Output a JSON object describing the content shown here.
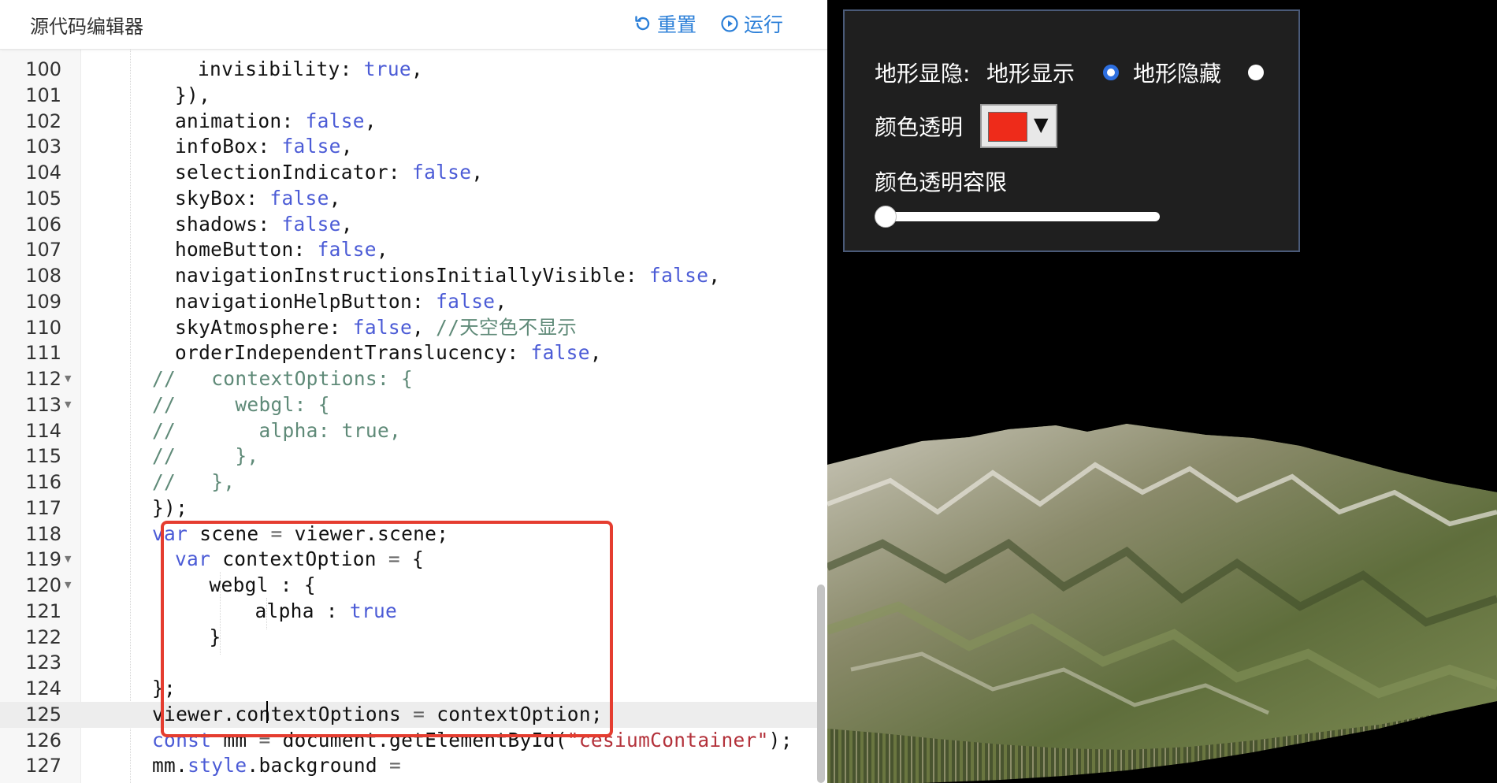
{
  "editor": {
    "title": "源代码编辑器",
    "reset_label": "重置",
    "run_label": "运行",
    "lines": [
      {
        "n": "100",
        "indent": 1,
        "tokens": [
          [
            "key",
            "invisibility: "
          ],
          [
            "lit",
            "true"
          ],
          [
            "key",
            ","
          ]
        ]
      },
      {
        "n": "101",
        "indent": 0,
        "tokens": [
          [
            "key",
            "}),"
          ]
        ]
      },
      {
        "n": "102",
        "indent": 0,
        "tokens": [
          [
            "key",
            "animation: "
          ],
          [
            "lit",
            "false"
          ],
          [
            "key",
            ","
          ]
        ]
      },
      {
        "n": "103",
        "indent": 0,
        "tokens": [
          [
            "key",
            "infoBox: "
          ],
          [
            "lit",
            "false"
          ],
          [
            "key",
            ","
          ]
        ]
      },
      {
        "n": "104",
        "indent": 0,
        "tokens": [
          [
            "key",
            "selectionIndicator: "
          ],
          [
            "lit",
            "false"
          ],
          [
            "key",
            ","
          ]
        ]
      },
      {
        "n": "105",
        "indent": 0,
        "tokens": [
          [
            "key",
            "skyBox: "
          ],
          [
            "lit",
            "false"
          ],
          [
            "key",
            ","
          ]
        ]
      },
      {
        "n": "106",
        "indent": 0,
        "tokens": [
          [
            "key",
            "shadows: "
          ],
          [
            "lit",
            "false"
          ],
          [
            "key",
            ","
          ]
        ]
      },
      {
        "n": "107",
        "indent": 0,
        "tokens": [
          [
            "key",
            "homeButton: "
          ],
          [
            "lit",
            "false"
          ],
          [
            "key",
            ","
          ]
        ]
      },
      {
        "n": "108",
        "indent": 0,
        "tokens": [
          [
            "key",
            "navigationInstructionsInitiallyVisible: "
          ],
          [
            "lit",
            "false"
          ],
          [
            "key",
            ","
          ]
        ]
      },
      {
        "n": "109",
        "indent": 0,
        "tokens": [
          [
            "key",
            "navigationHelpButton: "
          ],
          [
            "lit",
            "false"
          ],
          [
            "key",
            ","
          ]
        ]
      },
      {
        "n": "110",
        "indent": 0,
        "tokens": [
          [
            "key",
            "skyAtmosphere: "
          ],
          [
            "lit",
            "false"
          ],
          [
            "key",
            ", "
          ],
          [
            "cmt",
            "//天空色不显示"
          ]
        ]
      },
      {
        "n": "111",
        "indent": 0,
        "tokens": [
          [
            "key",
            "orderIndependentTranslucency: "
          ],
          [
            "lit",
            "false"
          ],
          [
            "key",
            ","
          ]
        ]
      },
      {
        "n": "112",
        "indent": -1,
        "fold": true,
        "tokens": [
          [
            "cmt",
            "//   contextOptions: {"
          ]
        ]
      },
      {
        "n": "113",
        "indent": -1,
        "fold": true,
        "tokens": [
          [
            "cmt",
            "//     webgl: {"
          ]
        ]
      },
      {
        "n": "114",
        "indent": -1,
        "tokens": [
          [
            "cmt",
            "//       alpha: true,"
          ]
        ]
      },
      {
        "n": "115",
        "indent": -1,
        "tokens": [
          [
            "cmt",
            "//     },"
          ]
        ]
      },
      {
        "n": "116",
        "indent": -1,
        "tokens": [
          [
            "cmt",
            "//   },"
          ]
        ]
      },
      {
        "n": "117",
        "indent": -1,
        "tokens": [
          [
            "key",
            "});"
          ]
        ]
      },
      {
        "n": "118",
        "indent": -1,
        "tokens": [
          [
            "kw",
            "var"
          ],
          [
            "key",
            " scene "
          ],
          [
            "op",
            "="
          ],
          [
            "key",
            " viewer.scene;"
          ]
        ]
      },
      {
        "n": "119",
        "indent": 0,
        "fold": true,
        "tokens": [
          [
            "kw",
            "var"
          ],
          [
            "key",
            " contextOption "
          ],
          [
            "op",
            "="
          ],
          [
            "key",
            " {"
          ]
        ]
      },
      {
        "n": "120",
        "indent": 1.5,
        "fold": true,
        "tokens": [
          [
            "key",
            "webgl : {"
          ]
        ]
      },
      {
        "n": "121",
        "indent": 3.5,
        "tokens": [
          [
            "key",
            "alpha : "
          ],
          [
            "lit",
            "true"
          ]
        ]
      },
      {
        "n": "122",
        "indent": 1.5,
        "tokens": [
          [
            "key",
            "}"
          ]
        ]
      },
      {
        "n": "123",
        "indent": 0,
        "tokens": []
      },
      {
        "n": "124",
        "indent": -1,
        "tokens": [
          [
            "key",
            "};"
          ]
        ]
      },
      {
        "n": "125",
        "indent": -1,
        "active": true,
        "tokens": [
          [
            "key",
            "viewer.contextOptions "
          ],
          [
            "op",
            "="
          ],
          [
            "key",
            " contextOption;"
          ]
        ]
      },
      {
        "n": "126",
        "indent": -1,
        "tokens": [
          [
            "kw",
            "const"
          ],
          [
            "key",
            " mm "
          ],
          [
            "op",
            "="
          ],
          [
            "key",
            " document.getElementById("
          ],
          [
            "str",
            "\"cesiumContainer\""
          ],
          [
            "key",
            ");"
          ]
        ]
      },
      {
        "n": "127",
        "indent": -1,
        "tokens": [
          [
            "key",
            "mm."
          ],
          [
            "kw",
            "style"
          ],
          [
            "key",
            ".background "
          ],
          [
            "op",
            "="
          ]
        ]
      }
    ]
  },
  "panel": {
    "terrain_label": "地形显隐:",
    "show_label": "地形显示",
    "hide_label": "地形隐藏",
    "terrain_selected": "show",
    "color_label": "颜色透明",
    "color_value": "#ee2b1a",
    "tolerance_label": "颜色透明容限",
    "tolerance_value": 0
  },
  "colors": {
    "accent": "#2b7fd8",
    "highlight_box": "#e53d30"
  }
}
